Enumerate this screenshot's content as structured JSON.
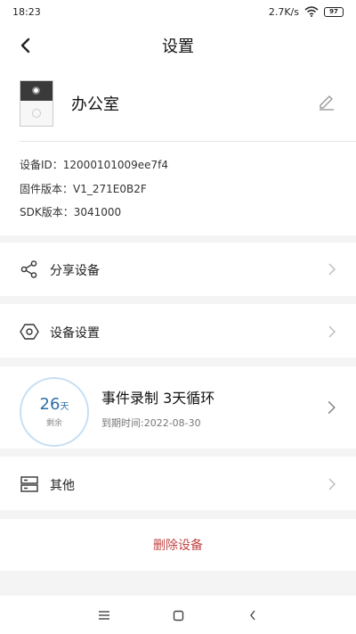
{
  "status_bar": {
    "time": "18:23",
    "network_speed": "2.7K/s",
    "battery": "97"
  },
  "header": {
    "title": "设置",
    "back_icon": "chevron-left-icon"
  },
  "device": {
    "name": "办公室",
    "device_id": "设备ID：12000101009ee7f4",
    "firmware": "固件版本：V1_271E0B2F",
    "sdk": "SDK版本：3041000"
  },
  "menu": {
    "share": {
      "label": "分享设备",
      "icon": "share-icon"
    },
    "settings": {
      "label": "设备设置",
      "icon": "hexagon-settings-icon"
    },
    "record": {
      "days": "26",
      "days_unit": "天",
      "remain": "剩余",
      "title": "事件录制 3天循环",
      "expire": "到期时间:2022-08-30"
    },
    "other": {
      "label": "其他",
      "icon": "server-icon"
    }
  },
  "delete_label": "删除设备",
  "colors": {
    "accent": "#2d6fa8",
    "danger": "#c44545",
    "ring": "#c7dff4"
  }
}
